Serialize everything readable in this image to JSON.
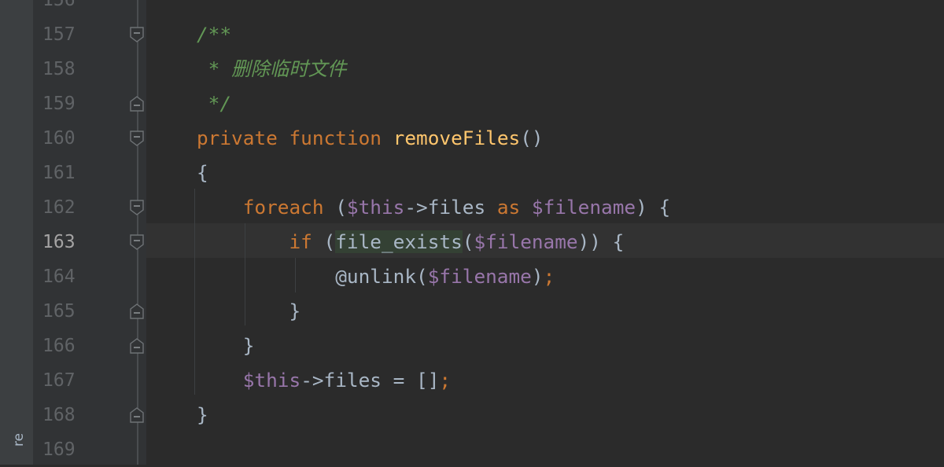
{
  "side_tool_window": {
    "label": "re"
  },
  "colors": {
    "background": "#2b2b2b",
    "gutter": "#313335",
    "comment": "#629755",
    "keyword": "#cc7832",
    "function": "#ffc66d",
    "variable": "#9876aa",
    "text": "#a9b7c6",
    "line_number": "#606366"
  },
  "editor": {
    "partial_top_line_number": "156",
    "current_line": "163",
    "lines": [
      {
        "number": "157",
        "fold": "open",
        "parts": [
          {
            "t": "/**",
            "c": "comment"
          }
        ]
      },
      {
        "number": "158",
        "fold": "none",
        "parts": [
          {
            "t": " * 删除临时文件",
            "c": "comment"
          }
        ]
      },
      {
        "number": "159",
        "fold": "close",
        "parts": [
          {
            "t": " */",
            "c": "comment"
          }
        ]
      },
      {
        "number": "160",
        "fold": "open",
        "parts": [
          {
            "t": "private",
            "c": "kw"
          },
          {
            "t": " ",
            "c": "plain"
          },
          {
            "t": "function",
            "c": "kw"
          },
          {
            "t": " ",
            "c": "plain"
          },
          {
            "t": "removeFiles",
            "c": "fn"
          },
          {
            "t": "()",
            "c": "plain"
          }
        ]
      },
      {
        "number": "161",
        "fold": "none",
        "parts": [
          {
            "t": "{",
            "c": "plain"
          }
        ]
      },
      {
        "number": "162",
        "fold": "open",
        "parts": [
          {
            "t": "    ",
            "c": "plain"
          },
          {
            "t": "foreach",
            "c": "kw"
          },
          {
            "t": " (",
            "c": "plain"
          },
          {
            "t": "$this",
            "c": "var"
          },
          {
            "t": "->files ",
            "c": "plain"
          },
          {
            "t": "as",
            "c": "kw"
          },
          {
            "t": " ",
            "c": "plain"
          },
          {
            "t": "$filename",
            "c": "var"
          },
          {
            "t": ") {",
            "c": "plain"
          }
        ]
      },
      {
        "number": "163",
        "fold": "open",
        "parts": [
          {
            "t": "        ",
            "c": "plain"
          },
          {
            "t": "if",
            "c": "kw"
          },
          {
            "t": " (",
            "c": "plain"
          },
          {
            "t": "file_exists",
            "c": "hl"
          },
          {
            "t": "(",
            "c": "plain"
          },
          {
            "t": "$filename",
            "c": "var"
          },
          {
            "t": ")) {",
            "c": "plain"
          }
        ]
      },
      {
        "number": "164",
        "fold": "none",
        "parts": [
          {
            "t": "            ",
            "c": "plain"
          },
          {
            "t": "@unlink(",
            "c": "plain"
          },
          {
            "t": "$filename",
            "c": "var"
          },
          {
            "t": ")",
            "c": "plain"
          },
          {
            "t": ";",
            "c": "kw"
          }
        ]
      },
      {
        "number": "165",
        "fold": "close",
        "parts": [
          {
            "t": "        }",
            "c": "plain"
          }
        ]
      },
      {
        "number": "166",
        "fold": "close",
        "parts": [
          {
            "t": "    }",
            "c": "plain"
          }
        ]
      },
      {
        "number": "167",
        "fold": "none",
        "parts": [
          {
            "t": "    ",
            "c": "plain"
          },
          {
            "t": "$this",
            "c": "var"
          },
          {
            "t": "->files = []",
            "c": "plain"
          },
          {
            "t": ";",
            "c": "kw"
          }
        ]
      },
      {
        "number": "168",
        "fold": "close",
        "parts": [
          {
            "t": "}",
            "c": "plain"
          }
        ]
      },
      {
        "number": "169",
        "fold": "none",
        "parts": []
      }
    ]
  }
}
